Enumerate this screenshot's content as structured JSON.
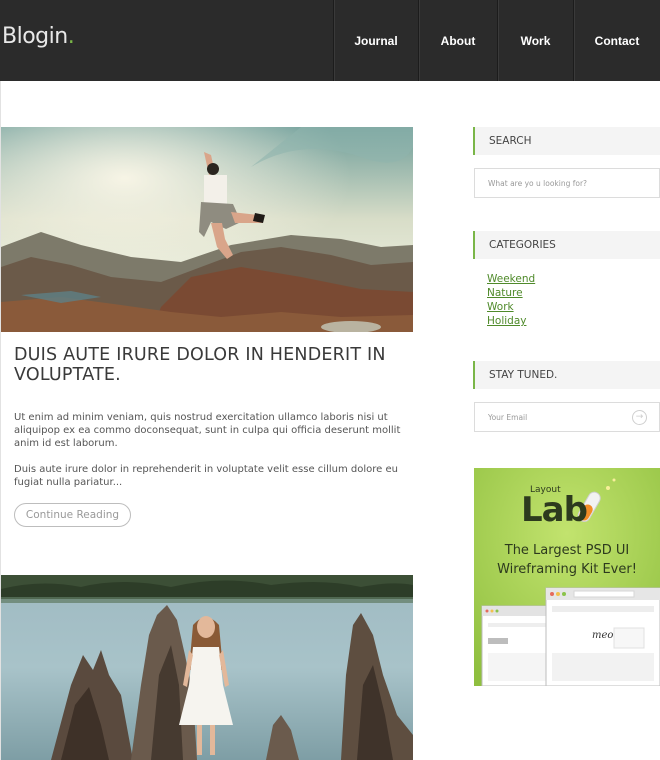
{
  "header": {
    "logo_text": "Blogin",
    "logo_dot": ".",
    "nav": [
      "Journal",
      "About",
      "Work",
      "Contact"
    ]
  },
  "post": {
    "title": "DUIS AUTE IRURE DOLOR IN HENDERIT IN VOLUPTATE.",
    "paragraph1": "Ut enim ad minim veniam, quis nostrud exercitation ullamco laboris nisi ut aliquipop ex ea commo doconsequat, sunt in culpa qui officia deserunt mollit anim id est laborum.",
    "paragraph2": "Duis aute irure dolor in reprehenderit in voluptate velit esse cillum dolore eu fugiat nulla pariatur...",
    "read_more": "Continue Reading"
  },
  "sidebar": {
    "search_heading": "SEARCH",
    "search_placeholder": "What are yo u looking for?",
    "categories_heading": "CATEGORIES",
    "categories": [
      "Weekend",
      "Nature",
      "Work",
      "Holiday"
    ],
    "stay_heading": "STAY TUNED.",
    "email_placeholder": "Your Email",
    "ad": {
      "logo_small": "Layout",
      "logo_big": "Lab",
      "tagline1": "The Largest PSD UI",
      "tagline2": "Wireframing Kit Ever!",
      "mock_brand": "meo"
    }
  },
  "colors": {
    "header_bg": "#2b2b2b",
    "accent": "#7ab648",
    "link": "#4f8a2a",
    "ad_bg": "#a8d15a"
  }
}
